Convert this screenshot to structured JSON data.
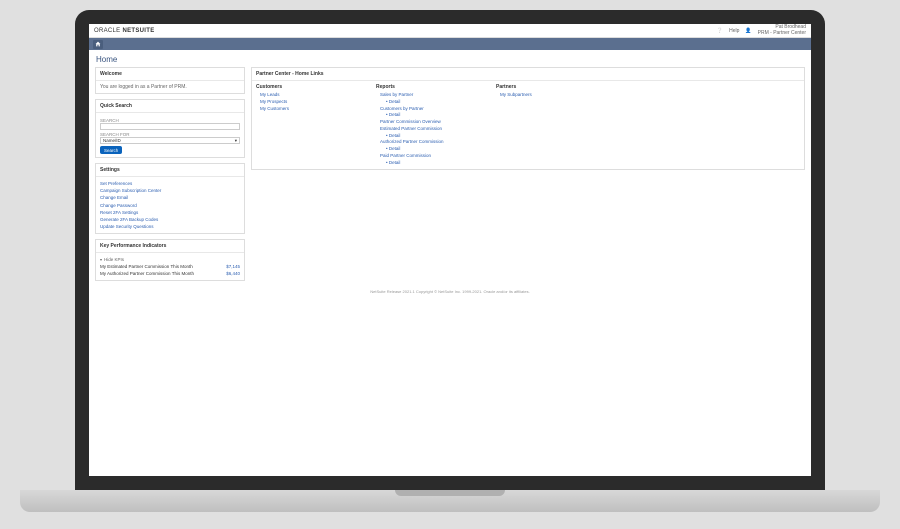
{
  "brand": {
    "prefix": "ORACLE",
    "suffix": "NETSUITE"
  },
  "topbar": {
    "help": "Help",
    "user_name": "Pat Brodhead",
    "user_role": "PRM - Partner Center"
  },
  "page": {
    "title": "Home"
  },
  "welcome": {
    "title": "Welcome",
    "message": "You are logged in as a Partner of PRM."
  },
  "quicksearch": {
    "title": "Quick Search",
    "search_label": "SEARCH",
    "search_value": "",
    "searchfor_label": "SEARCH FOR",
    "searchfor_value": "Name/ID",
    "button": "Search"
  },
  "settings": {
    "title": "Settings",
    "items": [
      "Set Preferences",
      "Campaign Subscription Center",
      "Change Email",
      "Change Password",
      "Reset 2FA Settings",
      "Generate 2FA Backup Codes",
      "Update Security Questions"
    ]
  },
  "kpi": {
    "title": "Key Performance Indicators",
    "hide_toggle": "Hide KPIs",
    "rows": [
      {
        "name": "My Estimated Partner Commission This Month",
        "value": "$7,145"
      },
      {
        "name": "My Authorized Partner Commission This Month",
        "value": "$6,440"
      }
    ]
  },
  "homelinks": {
    "title": "Partner Center - Home Links",
    "columns": [
      {
        "heading": "Customers",
        "links": [
          {
            "label": "My Leads"
          },
          {
            "label": "My Prospects"
          },
          {
            "label": "My Customers"
          }
        ]
      },
      {
        "heading": "Reports",
        "links": [
          {
            "label": "Sales by Partner"
          },
          {
            "label": "Detail",
            "sub": true
          },
          {
            "label": "Customers by Partner"
          },
          {
            "label": "Detail",
            "sub": true
          },
          {
            "label": "Partner Commission Overview"
          },
          {
            "label": "Estimated Partner Commission"
          },
          {
            "label": "Detail",
            "sub": true
          },
          {
            "label": "Authorized Partner Commission"
          },
          {
            "label": "Detail",
            "sub": true
          },
          {
            "label": "Paid Partner Commission"
          },
          {
            "label": "Detail",
            "sub": true
          }
        ]
      },
      {
        "heading": "Partners",
        "links": [
          {
            "label": "My Subpartners"
          }
        ]
      }
    ]
  },
  "footer": "NetSuite Release 2021.1 Copyright © NetSuite Inc. 1999-2021. Oracle and/or its affiliates."
}
